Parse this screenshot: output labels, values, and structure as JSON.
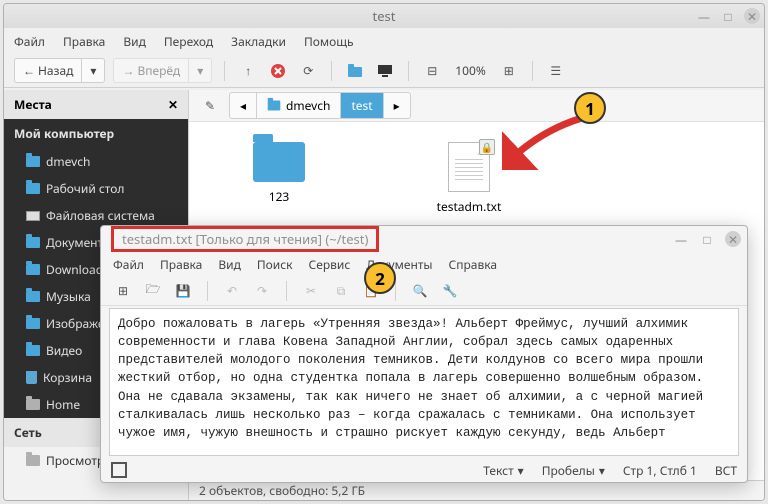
{
  "fm": {
    "title": "test",
    "menu": [
      "Файл",
      "Правка",
      "Вид",
      "Переход",
      "Закладки",
      "Помощь"
    ],
    "toolbar": {
      "back": "Назад",
      "forward": "Вперёд",
      "zoom": "100%"
    },
    "sidebar": {
      "header": "Места",
      "group1": "Мой компьютер",
      "items": [
        {
          "icon": "folder",
          "label": "dmevch"
        },
        {
          "icon": "folder",
          "label": "Рабочий стол"
        },
        {
          "icon": "drive",
          "label": "Файловая система"
        },
        {
          "icon": "folder",
          "label": "Документы"
        },
        {
          "icon": "folder",
          "label": "Downloads"
        },
        {
          "icon": "folder",
          "label": "Музыка"
        },
        {
          "icon": "folder",
          "label": "Изображения"
        },
        {
          "icon": "folder",
          "label": "Видео"
        },
        {
          "icon": "trash",
          "label": "Корзина"
        },
        {
          "icon": "folder-gray",
          "label": "Home"
        }
      ],
      "group2": "Сеть",
      "network_item": "Просмотреть"
    },
    "path": {
      "seg1": "dmevch",
      "seg2": "test"
    },
    "files": {
      "folder_name": "123",
      "doc_name": "testadm.txt"
    },
    "status": "2 объектов, свободно: 5,2 ГБ"
  },
  "ed": {
    "title": "testadm.txt [Только для чтения] (~/test)",
    "menu": [
      "Файл",
      "Правка",
      "Вид",
      "Поиск",
      "Сервис",
      "Документы",
      "Справка"
    ],
    "content": "Добро пожаловать в лагерь «Утренняя звезда»! Альберт Фреймус, лучший алхимик современности и глава Ковена Западной Англии, собрал здесь самых одаренных представителей молодого поколения темников. Дети колдунов со всего мира прошли жесткий отбор, но одна студентка попала в лагерь совершенно волшебным образом. Она не сдавала экзамены, так как ничего не знает об алхимии, а с черной магией сталкивалась лишь несколько раз – когда сражалась с темниками. Она использует чужое имя, чужую внешность и страшно рискует каждую секунду, ведь Альберт",
    "status": {
      "text": "Текст",
      "spaces": "Пробелы",
      "pos": "Стр 1, Стлб 1",
      "ins": "ВСТ"
    }
  },
  "annot": {
    "one": "1",
    "two": "2"
  }
}
